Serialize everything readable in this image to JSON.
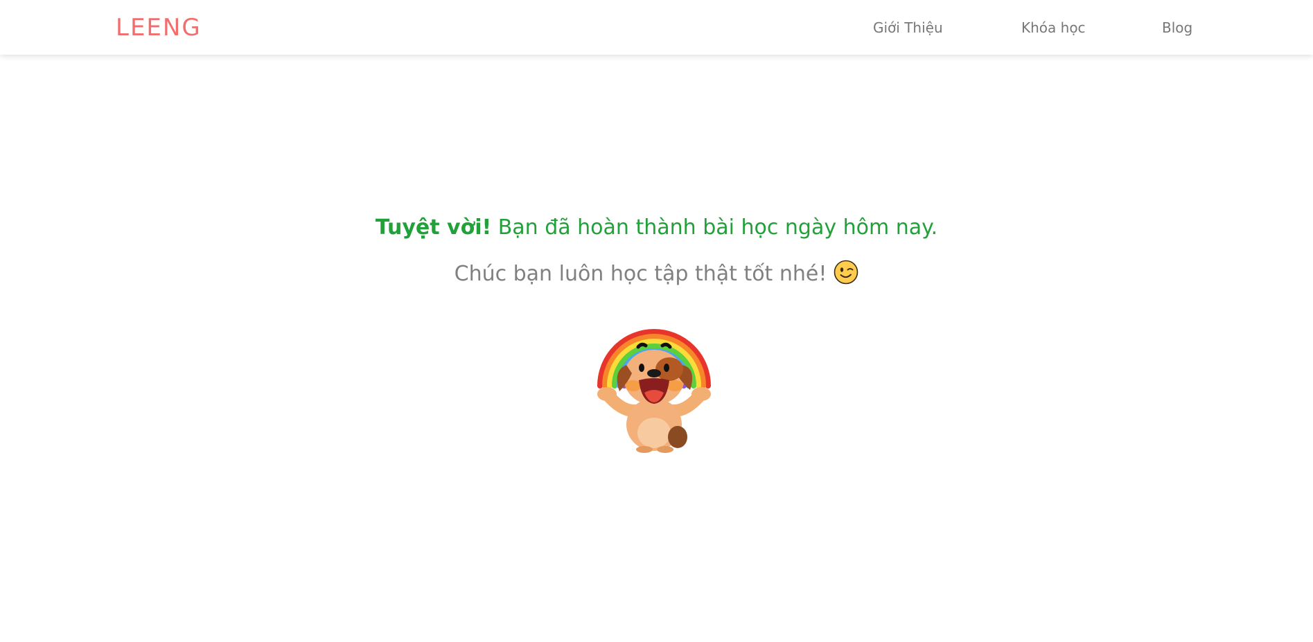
{
  "brand": {
    "name": "LEENG"
  },
  "nav": {
    "items": [
      {
        "label": "Giới Thiệu"
      },
      {
        "label": "Khóa học"
      },
      {
        "label": "Blog"
      }
    ]
  },
  "main": {
    "headline_bold": "Tuyệt vời!",
    "headline_rest": " Bạn đã hoàn thành bài học ngày hôm nay.",
    "subline": "Chúc bạn luôn học tập thật tốt nhé!",
    "emoji_icon": "winking-face-icon",
    "sticker": "puppy-rainbow-sticker"
  },
  "colors": {
    "brand": "#f26d6d",
    "success": "#22a03a",
    "muted": "#808080",
    "nav_text": "#777777"
  }
}
